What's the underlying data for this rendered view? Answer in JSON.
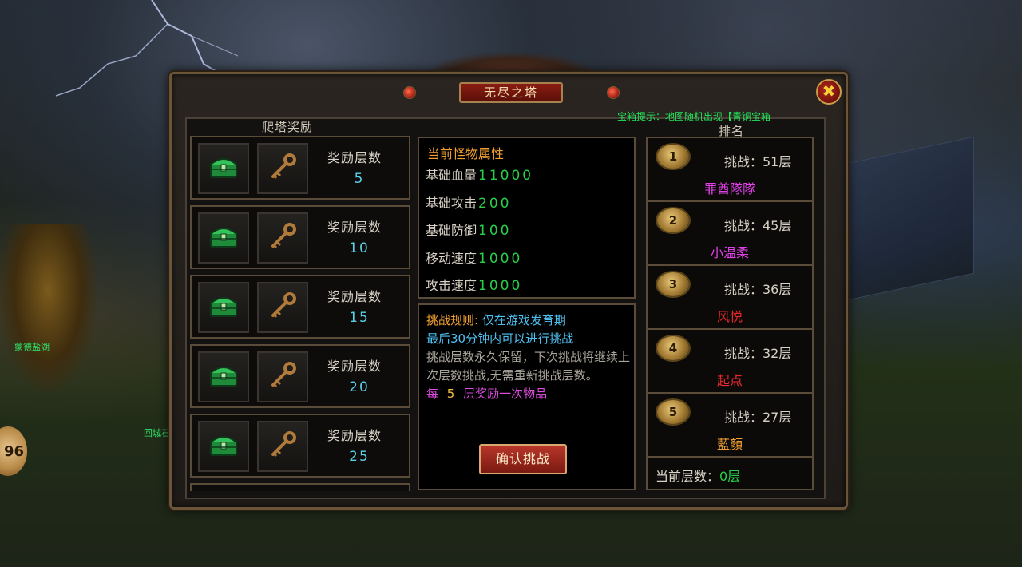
{
  "title": "无尽之塔",
  "close_icon": "close-x-icon",
  "marquee": "宝箱提示：地图随机出现【青铜宝箱",
  "rewards": {
    "heading": "爬塔奖励",
    "item_icons": [
      "green-chest-icon",
      "bronze-key-icon"
    ],
    "rows": [
      {
        "label": "奖励层数",
        "value": "5"
      },
      {
        "label": "奖励层数",
        "value": "10"
      },
      {
        "label": "奖励层数",
        "value": "15"
      },
      {
        "label": "奖励层数",
        "value": "20"
      },
      {
        "label": "奖励层数",
        "value": "25"
      }
    ]
  },
  "monster": {
    "heading": "当前怪物属性",
    "stats": [
      {
        "label": "基础血量",
        "value": "11000"
      },
      {
        "label": "基础攻击",
        "value": "200"
      },
      {
        "label": "基础防御",
        "value": "100"
      },
      {
        "label": "移动速度",
        "value": "1000"
      },
      {
        "label": "攻击速度",
        "value": "1000"
      }
    ]
  },
  "rules": {
    "label": "挑战规则:",
    "line1": "仅在游戏发育期",
    "line2": "最后30分钟内可以进行挑战",
    "line3": "挑战层数永久保留，下次挑战将继续上次层数挑战,无需重新挑战层数。",
    "reward_prefix": "每",
    "reward_num": "5",
    "reward_suffix": "层奖励一次物品",
    "confirm_label": "确认挑战"
  },
  "ranking": {
    "heading": "排名",
    "entries": [
      {
        "rank": "1",
        "challenge": "挑战：51层",
        "name": "罪酋隊隊",
        "color": "#e040e8"
      },
      {
        "rank": "2",
        "challenge": "挑战：45层",
        "name": "小温柔",
        "color": "#e040e8"
      },
      {
        "rank": "3",
        "challenge": "挑战：36层",
        "name": "风悦",
        "color": "#e8282a"
      },
      {
        "rank": "4",
        "challenge": "挑战：32层",
        "name": "起点",
        "color": "#e8282a"
      },
      {
        "rank": "5",
        "challenge": "挑战：27层",
        "name": "藍顏",
        "color": "#f0a030"
      }
    ],
    "current_label": "当前层数：",
    "current_value": "0层"
  },
  "background": {
    "avatar_text": "96",
    "npc_labels": [
      "蒙德盐湖",
      "回城石"
    ]
  }
}
